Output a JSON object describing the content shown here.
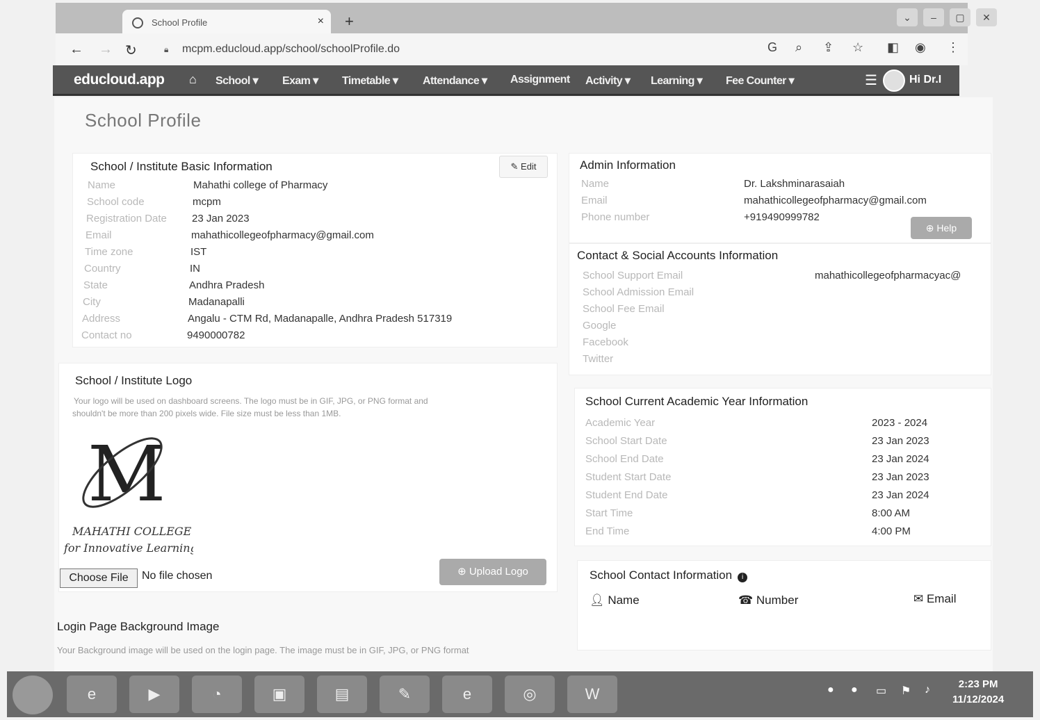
{
  "browser": {
    "tab_title": "School Profile",
    "tab_close": "×",
    "new_tab": "+",
    "url": "mcpm.educloud.app/school/schoolProfile.do",
    "nav_icons": [
      "back-arrow-icon",
      "forward-arrow-icon",
      "reload-icon"
    ],
    "toolbar_icons": [
      "google-icon",
      "zoom-icon",
      "share-icon",
      "star-icon",
      "sidebar-icon",
      "profile-icon",
      "menu-dots-icon"
    ]
  },
  "navbar": {
    "brand": "educloud.app",
    "items": [
      "School",
      "Exam",
      "Timetable",
      "Attendance",
      "Assignment",
      "Activity",
      "Learning",
      "Fee Counter"
    ],
    "user": "Hi Dr.I"
  },
  "page": {
    "title": "School Profile"
  },
  "basic_info": {
    "heading": "School / Institute Basic Information",
    "edit_label": "Edit",
    "rows": [
      {
        "label": "Name",
        "value": "Mahathi college of Pharmacy"
      },
      {
        "label": "School code",
        "value": "mcpm"
      },
      {
        "label": "Registration Date",
        "value": "23 Jan 2023"
      },
      {
        "label": "Email",
        "value": "mahathicollegeofpharmacy@gmail.com"
      },
      {
        "label": "Time zone",
        "value": "IST"
      },
      {
        "label": "Country",
        "value": "IN"
      },
      {
        "label": "State",
        "value": "Andhra Pradesh"
      },
      {
        "label": "City",
        "value": "Madanapalli"
      },
      {
        "label": "Address",
        "value": "Angalu - CTM Rd, Madanapalle, Andhra Pradesh 517319"
      },
      {
        "label": "Contact no",
        "value": "9490000782"
      }
    ]
  },
  "logo_section": {
    "heading": "School / Institute Logo",
    "note_line1": "Your logo will be used on dashboard screens. The logo must be in GIF, JPG, or PNG format and",
    "note_line2": "shouldn't be more than 200 pixels wide. File size must be less than 1MB.",
    "logo_line1": "MAHATHI COLLEGE",
    "logo_line2": "for Innovative Learning",
    "choose_file": "Choose File",
    "no_file": "No file chosen",
    "upload_label": "Upload Logo"
  },
  "login_bg": {
    "heading": "Login Page Background Image",
    "note": "Your Background image will be used on the login page. The image must be in GIF, JPG, or PNG format"
  },
  "admin_info": {
    "heading": "Admin Information",
    "rows": [
      {
        "label": "Name",
        "value": "Dr. Lakshminarasaiah"
      },
      {
        "label": "Email",
        "value": "mahathicollegeofpharmacy@gmail.com"
      },
      {
        "label": "Phone number",
        "value": "+919490999782"
      }
    ],
    "help_label": "Help"
  },
  "contact_social": {
    "heading": "Contact & Social Accounts Information",
    "rows": [
      {
        "label": "School Support Email",
        "value": "mahathicollegeofpharmacyac@"
      },
      {
        "label": "School Admission Email",
        "value": ""
      },
      {
        "label": "School Fee Email",
        "value": ""
      },
      {
        "label": "Google",
        "value": ""
      },
      {
        "label": "Facebook",
        "value": ""
      },
      {
        "label": "Twitter",
        "value": ""
      }
    ]
  },
  "academic_year": {
    "heading": "School Current Academic Year Information",
    "rows": [
      {
        "label": "Academic Year",
        "value": "2023 - 2024"
      },
      {
        "label": "School Start Date",
        "value": "23 Jan 2023"
      },
      {
        "label": "School End Date",
        "value": "23 Jan 2024"
      },
      {
        "label": "Student Start Date",
        "value": "23 Jan 2023"
      },
      {
        "label": "Student End Date",
        "value": "23 Jan 2024"
      },
      {
        "label": "Start Time",
        "value": "8:00 AM"
      },
      {
        "label": "End Time",
        "value": "4:00 PM"
      }
    ]
  },
  "school_contact": {
    "heading": "School Contact Information",
    "columns": [
      "Name",
      "Number",
      "Email"
    ]
  },
  "taskbar": {
    "apps": [
      "ie-icon",
      "media-icon",
      "firefox-icon",
      "photo-icon",
      "folder-icon",
      "paint-icon",
      "edge-icon",
      "chrome-icon",
      "word-icon"
    ],
    "time": "2:23 PM",
    "date": "11/12/2024"
  }
}
